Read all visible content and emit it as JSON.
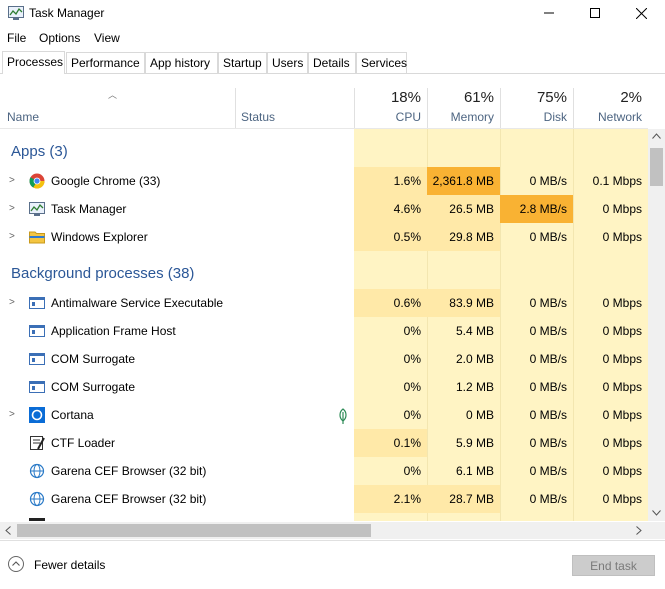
{
  "window": {
    "title": "Task Manager",
    "minimize": "—",
    "maximize": "☐",
    "close": "✕"
  },
  "menu": [
    "File",
    "Options",
    "View"
  ],
  "tabs": [
    "Processes",
    "Performance",
    "App history",
    "Startup",
    "Users",
    "Details",
    "Services"
  ],
  "columns": {
    "name": "Name",
    "status": "Status",
    "cpu": {
      "pct": "18%",
      "label": "CPU"
    },
    "memory": {
      "pct": "61%",
      "label": "Memory"
    },
    "disk": {
      "pct": "75%",
      "label": "Disk"
    },
    "network": {
      "pct": "2%",
      "label": "Network"
    }
  },
  "groups": {
    "apps": "Apps (3)",
    "background": "Background processes (38)"
  },
  "apps": [
    {
      "name": "Google Chrome (33)",
      "icon": "chrome-icon",
      "cpu": "1.6%",
      "memory": "2,361.8 MB",
      "disk": "0 MB/s",
      "network": "0.1 Mbps"
    },
    {
      "name": "Task Manager",
      "icon": "task-manager-icon",
      "cpu": "4.6%",
      "memory": "26.5 MB",
      "disk": "2.8 MB/s",
      "network": "0 Mbps"
    },
    {
      "name": "Windows Explorer",
      "icon": "folder-icon",
      "cpu": "0.5%",
      "memory": "29.8 MB",
      "disk": "0 MB/s",
      "network": "0 Mbps"
    }
  ],
  "background": [
    {
      "name": "Antimalware Service Executable",
      "icon": "service-icon",
      "cpu": "0.6%",
      "memory": "83.9 MB",
      "disk": "0 MB/s",
      "network": "0 Mbps"
    },
    {
      "name": "Application Frame Host",
      "icon": "service-icon",
      "cpu": "0%",
      "memory": "5.4 MB",
      "disk": "0 MB/s",
      "network": "0 Mbps"
    },
    {
      "name": "COM Surrogate",
      "icon": "service-icon",
      "cpu": "0%",
      "memory": "2.0 MB",
      "disk": "0 MB/s",
      "network": "0 Mbps"
    },
    {
      "name": "COM Surrogate",
      "icon": "service-icon",
      "cpu": "0%",
      "memory": "1.2 MB",
      "disk": "0 MB/s",
      "network": "0 Mbps"
    },
    {
      "name": "Cortana",
      "icon": "cortana-icon",
      "cpu": "0%",
      "memory": "0 MB",
      "disk": "0 MB/s",
      "network": "0 Mbps"
    },
    {
      "name": "CTF Loader",
      "icon": "ctf-icon",
      "cpu": "0.1%",
      "memory": "5.9 MB",
      "disk": "0 MB/s",
      "network": "0 Mbps"
    },
    {
      "name": "Garena CEF Browser (32 bit)",
      "icon": "globe-icon",
      "cpu": "0%",
      "memory": "6.1 MB",
      "disk": "0 MB/s",
      "network": "0 Mbps"
    },
    {
      "name": "Garena CEF Browser (32 bit)",
      "icon": "globe-icon",
      "cpu": "2.1%",
      "memory": "28.7 MB",
      "disk": "0 MB/s",
      "network": "0 Mbps"
    }
  ],
  "footer": {
    "fewer_details": "Fewer details",
    "end_task": "End task"
  },
  "colors": {
    "heat_light": "#fff4c4",
    "heat_mid": "#ffe9a8",
    "heat_high": "#ffd27f",
    "heat_max": "#f9b233",
    "group_text": "#2b5797"
  }
}
